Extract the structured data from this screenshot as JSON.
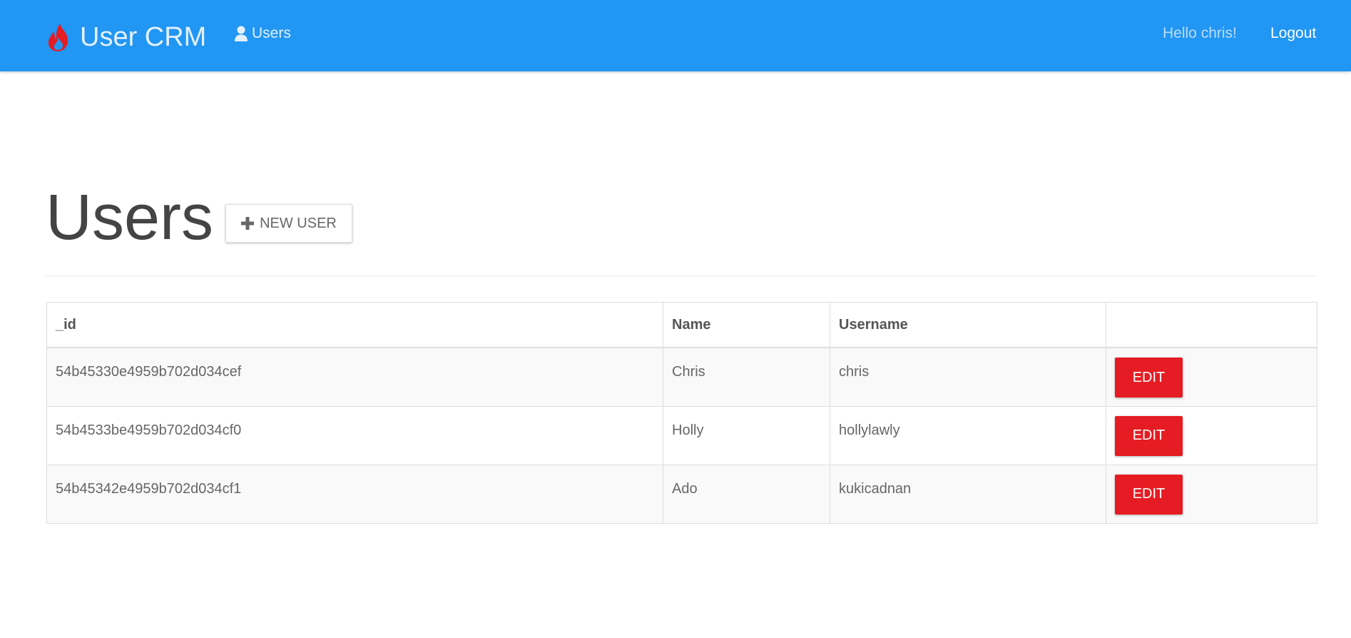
{
  "navbar": {
    "brand_icon": "flame-icon",
    "brand_icon_color": "#e51c23",
    "brand_text": "User CRM",
    "background_color": "#2196f3",
    "users_link": {
      "icon": "user-icon",
      "label": "Users"
    },
    "greeting": "Hello chris!",
    "logout_label": "Logout"
  },
  "header": {
    "title": "Users",
    "new_user_button": {
      "icon": "plus-icon",
      "label": "NEW USER"
    }
  },
  "users_table": {
    "columns": [
      "_id",
      "Name",
      "Username",
      ""
    ],
    "rows": [
      {
        "id": "54b45330e4959b702d034cef",
        "name": "Chris",
        "username": "chris",
        "action_label": "EDIT"
      },
      {
        "id": "54b4533be4959b702d034cf0",
        "name": "Holly",
        "username": "hollylawly",
        "action_label": "EDIT"
      },
      {
        "id": "54b45342e4959b702d034cf1",
        "name": "Ado",
        "username": "kukicadnan",
        "action_label": "EDIT"
      }
    ],
    "edit_button_color": "#e51c23"
  }
}
